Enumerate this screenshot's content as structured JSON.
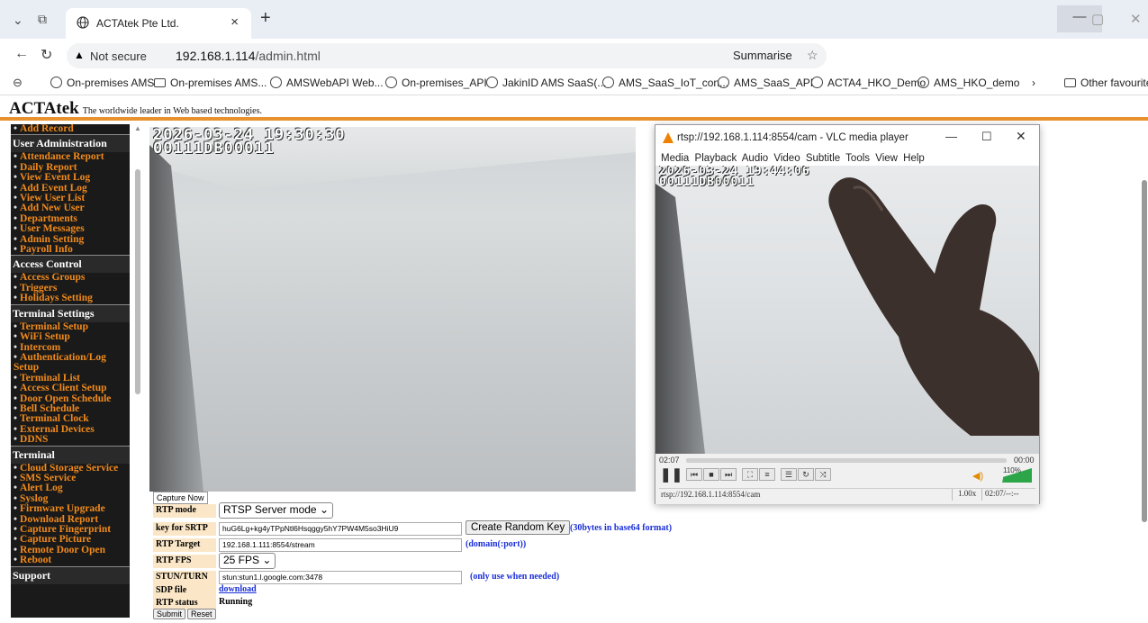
{
  "browser": {
    "tab_title": "ACTAtek Pte Ltd.",
    "url_security": "Not secure",
    "url_host": "192.168.1.114",
    "url_path": "/admin.html",
    "summarise": "Summarise",
    "bookmarks": [
      "On-premises AMS",
      "On-premises AMS...",
      "AMSWebAPI Web...",
      "On-premises_API",
      "JakinID AMS SaaS(...",
      "AMS_SaaS_IoT_con...",
      "AMS_SaaS_API",
      "ACTA4_HKO_Demo",
      "AMS_HKO_demo"
    ],
    "other_favourites": "Other favourites"
  },
  "brand": {
    "logo": "ACTAtek",
    "tagline": "The worldwide leader in Web based technologies."
  },
  "menu": [
    {
      "type": "item",
      "label": "Add Record"
    },
    {
      "type": "section",
      "label": "User Administration"
    },
    {
      "type": "item",
      "label": "Attendance Report"
    },
    {
      "type": "item",
      "label": "Daily Report"
    },
    {
      "type": "item",
      "label": "View Event Log"
    },
    {
      "type": "item",
      "label": "Add Event Log"
    },
    {
      "type": "item",
      "label": "View User List"
    },
    {
      "type": "item",
      "label": "Add New User"
    },
    {
      "type": "item",
      "label": "Departments"
    },
    {
      "type": "item",
      "label": "User Messages"
    },
    {
      "type": "item",
      "label": "Admin Setting"
    },
    {
      "type": "item",
      "label": "Payroll Info"
    },
    {
      "type": "section",
      "label": "Access Control"
    },
    {
      "type": "item",
      "label": "Access Groups"
    },
    {
      "type": "item",
      "label": "Triggers"
    },
    {
      "type": "item",
      "label": "Holidays Setting"
    },
    {
      "type": "section",
      "label": "Terminal Settings"
    },
    {
      "type": "item",
      "label": "Terminal Setup"
    },
    {
      "type": "item",
      "label": "WiFi Setup"
    },
    {
      "type": "item",
      "label": "Intercom"
    },
    {
      "type": "item",
      "label": "Authentication/Log Setup"
    },
    {
      "type": "item",
      "label": "Terminal List"
    },
    {
      "type": "item",
      "label": "Access Client Setup"
    },
    {
      "type": "item",
      "label": "Door Open Schedule"
    },
    {
      "type": "item",
      "label": "Bell Schedule"
    },
    {
      "type": "item",
      "label": "Terminal Clock"
    },
    {
      "type": "item",
      "label": "External Devices"
    },
    {
      "type": "item",
      "label": "DDNS"
    },
    {
      "type": "section",
      "label": "Terminal"
    },
    {
      "type": "item",
      "label": "Cloud Storage Service"
    },
    {
      "type": "item",
      "label": "SMS Service"
    },
    {
      "type": "item",
      "label": "Alert Log"
    },
    {
      "type": "item",
      "label": "Syslog"
    },
    {
      "type": "item",
      "label": "Firmware Upgrade"
    },
    {
      "type": "item",
      "label": "Download Report"
    },
    {
      "type": "item",
      "label": "Capture Fingerprint"
    },
    {
      "type": "item",
      "label": "Capture Picture"
    },
    {
      "type": "item",
      "label": "Remote Door Open"
    },
    {
      "type": "item",
      "label": "Reboot"
    },
    {
      "type": "section",
      "label": "Support"
    }
  ],
  "camera": {
    "osd_datetime": "2026-03-24 19:30:30",
    "osd_id": "00111DB00011",
    "capture_button": "Capture Now"
  },
  "form": {
    "rtp_mode_label": "RTP mode",
    "rtp_mode_value": "RTSP Server mode",
    "srtp_label": "key for SRTP",
    "srtp_value": "huG6Lg+kg4yTPpNtl6Hsqggy5hY7PW4M5so3HiU9",
    "create_key_button": "Create Random Key",
    "srtp_hint": "(30bytes in base64 format)",
    "rtp_target_label": "RTP Target",
    "rtp_target_value": "192.168.1.111:8554/stream",
    "rtp_target_hint": "(domain(:port))",
    "fps_label": "RTP FPS",
    "fps_value": "25 FPS",
    "stun_label": "STUN/TURN",
    "stun_value": "stun:stun1.l.google.com:3478",
    "stun_hint": "(only use when needed)",
    "sdp_label": "SDP file",
    "sdp_link": "download",
    "status_label": "RTP status",
    "status_value": "Running",
    "submit": "Submit",
    "reset": "Reset"
  },
  "vlc": {
    "title": "rtsp://192.168.1.114:8554/cam - VLC media player",
    "menu": [
      "Media",
      "Playback",
      "Audio",
      "Video",
      "Subtitle",
      "Tools",
      "View",
      "Help"
    ],
    "osd_datetime": "2026-03-24 19:44:06",
    "osd_id": "00111DB00011",
    "elapsed": "02:07",
    "remaining": "00:00",
    "volume": "110%",
    "status_url": "rtsp://192.168.1.114:8554/cam",
    "speed": "1.00x",
    "time_status": "02:07/--:--"
  }
}
